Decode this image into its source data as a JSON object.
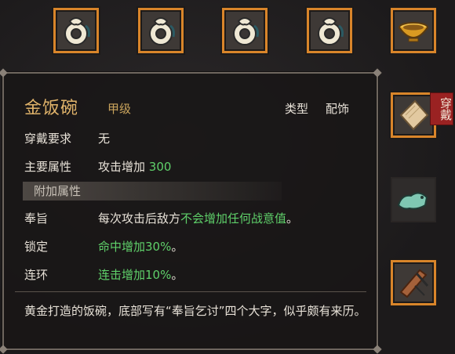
{
  "inventory": {
    "top_row_icons": [
      "jade-pendant-icon",
      "jade-pendant-icon",
      "jade-pendant-icon",
      "jade-pendant-icon",
      "golden-bowl-icon"
    ],
    "right_column_icons": [
      "parchment-icon",
      "jade-beast-icon",
      "wooden-scroll-icon"
    ],
    "worn_badge": "穿戴"
  },
  "tooltip": {
    "item_name": "金饭碗",
    "grade": "甲级",
    "type_label": "类型",
    "type_value": "配饰",
    "requirement_label": "穿戴要求",
    "requirement_value": "无",
    "main_attr_label": "主要属性",
    "main_attr_text": "攻击增加",
    "main_attr_value": "300",
    "extra_section_title": "附加属性",
    "extra": [
      {
        "label": "奉旨",
        "text": "每次攻击后敌方",
        "green": "不会增加任何战意值",
        "tail": "。"
      },
      {
        "label": "锁定",
        "text": "",
        "green": "命中增加30%",
        "tail": "。"
      },
      {
        "label": "连环",
        "text": "",
        "green": "连击增加10%",
        "tail": "。"
      }
    ],
    "description": "黄金打造的饭碗，底部写有“奉旨乞讨”四个大字，似乎颇有来历。"
  },
  "colors": {
    "equipped_border": "#d9852a",
    "title": "#e0b36a",
    "green": "#5fd06a",
    "worn_badge": "#9a2222"
  }
}
